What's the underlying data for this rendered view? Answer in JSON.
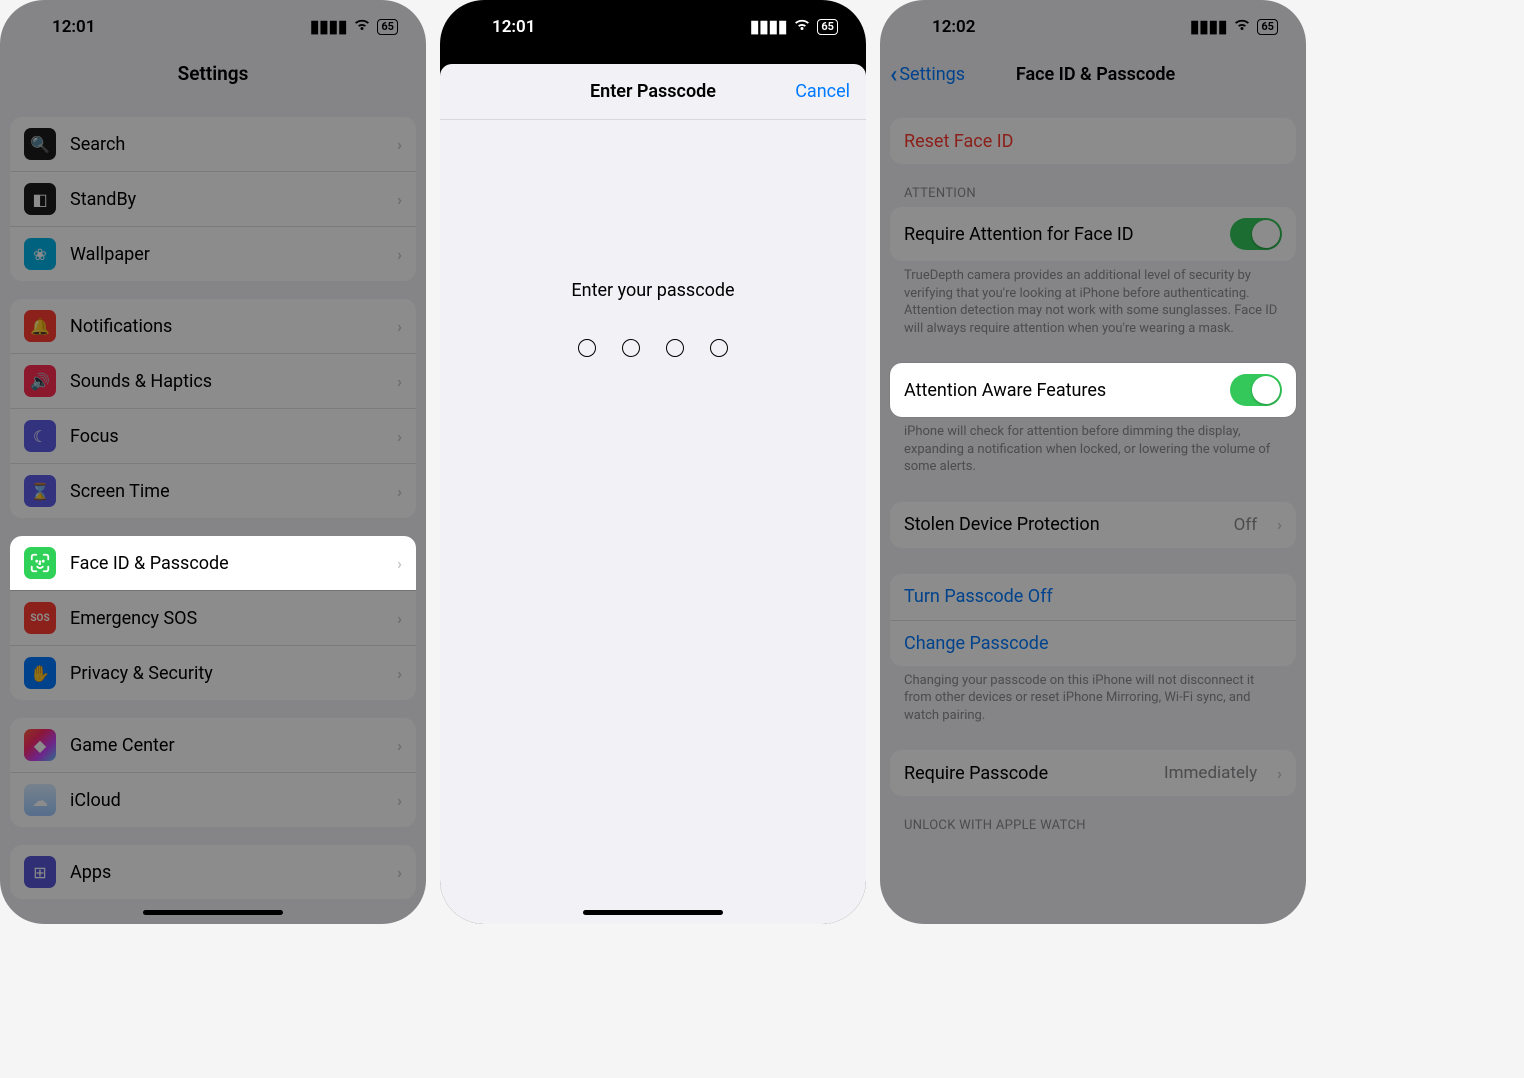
{
  "phone1": {
    "status": {
      "time": "12:01",
      "battery": "65"
    },
    "title": "Settings",
    "groups": {
      "g1": [
        {
          "label": "Search",
          "iconBg": "#1c1c1e",
          "glyph": "🔍"
        },
        {
          "label": "StandBy",
          "iconBg": "#1c1c1e",
          "glyph": "▭"
        },
        {
          "label": "Wallpaper",
          "iconBg": "#00b3e6",
          "glyph": "❀"
        }
      ],
      "g2": [
        {
          "label": "Notifications",
          "iconBg": "#ff3b30",
          "glyph": "🔔"
        },
        {
          "label": "Sounds & Haptics",
          "iconBg": "#ff2d55",
          "glyph": "🔊"
        },
        {
          "label": "Focus",
          "iconBg": "#5e5ce6",
          "glyph": "☾"
        },
        {
          "label": "Screen Time",
          "iconBg": "#5e5ce6",
          "glyph": "⌛"
        }
      ],
      "g3": [
        {
          "label": "Face ID & Passcode",
          "iconBg": "#30d158",
          "glyph": "faceid",
          "highlight": true
        },
        {
          "label": "Emergency SOS",
          "iconBg": "#ff3b30",
          "glyph": "SOS"
        },
        {
          "label": "Privacy & Security",
          "iconBg": "#007aff",
          "glyph": "✋"
        }
      ],
      "g4": [
        {
          "label": "Game Center",
          "iconBg": "linear-gradient(135deg,#ff5e3a,#ff2a68,#c644fc,#5ac8fa)",
          "glyph": "◆"
        },
        {
          "label": "iCloud",
          "iconBg": "linear-gradient(180deg,#5ac8fa,#007aff)",
          "glyph": "☁"
        }
      ],
      "g5": [
        {
          "label": "Apps",
          "iconBg": "#5856d6",
          "glyph": "⊞"
        }
      ]
    }
  },
  "phone2": {
    "status": {
      "time": "12:01",
      "battery": "65"
    },
    "modal": {
      "title": "Enter Passcode",
      "cancel": "Cancel",
      "prompt": "Enter your passcode"
    }
  },
  "phone3": {
    "status": {
      "time": "12:02",
      "battery": "65"
    },
    "backLabel": "Settings",
    "title": "Face ID & Passcode",
    "reset": "Reset Face ID",
    "attentionHeader": "ATTENTION",
    "requireAttention": "Require Attention for Face ID",
    "requireAttentionFooter": "TrueDepth camera provides an additional level of security by verifying that you're looking at iPhone before authenticating. Attention detection may not work with some sunglasses. Face ID will always require attention when you're wearing a mask.",
    "attentionAware": "Attention Aware Features",
    "attentionAwareFooter": "iPhone will check for attention before dimming the display, expanding a notification when locked, or lowering the volume of some alerts.",
    "stolenDevice": "Stolen Device Protection",
    "stolenDeviceValue": "Off",
    "turnPasscodeOff": "Turn Passcode Off",
    "changePasscode": "Change Passcode",
    "changePasscodeFooter": "Changing your passcode on this iPhone will not disconnect it from other devices or reset iPhone Mirroring, Wi-Fi sync, and watch pairing.",
    "requirePasscode": "Require Passcode",
    "requirePasscodeValue": "Immediately",
    "unlockWatch": "UNLOCK WITH APPLE WATCH"
  }
}
